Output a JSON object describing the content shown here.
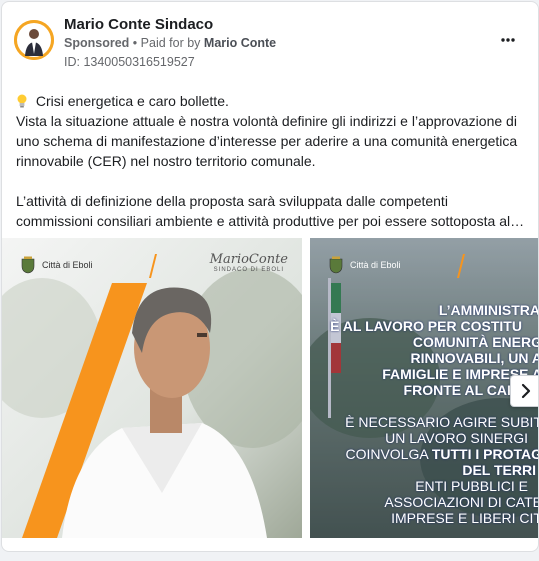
{
  "post": {
    "page_name": "Mario Conte Sindaco",
    "sponsored": "Sponsored",
    "bullet": "•",
    "paid_for_prefix": "Paid for by",
    "paid_for_name": "Mario Conte",
    "ad_id": "ID: 1340050316519527",
    "text": {
      "line1": "Crisi energetica e caro bollette.",
      "para1": "Vista la situazione attuale è nostra volontà definire gli indirizzi e l’approvazione di uno schema di manifestazione d’interesse per aderire a una comunità energetica rinnovabile (CER) nel nostro territorio comunale.",
      "para2": "L’attività di definizione della proposta sarà sviluppata dalle competenti commissioni consiliari ambiente e attività produttive per poi essere sottoposta al…"
    }
  },
  "carousel": {
    "slide1": {
      "city_label": "Città di Eboli",
      "signature": "MarioConte",
      "signature_sub": "SINDACO DI EBOLI"
    },
    "slide2": {
      "city_label": "Città di Eboli",
      "headline": [
        "L’AMMINISTRA",
        "È AL LAVORO PER COSTITU",
        "COMUNITÀ ENERG",
        "RINNOVABILI, UN A",
        "FAMIGLIE E IMPRESE A",
        "FRONTE AL CARO"
      ],
      "body": [
        "È NECESSARIO AGIRE SUBIT",
        "UN LAVORO SINERGI"
      ],
      "body_line3_pre": "COINVOLGA ",
      "body_line3_bold": "TUTTI I PROTAG",
      "body_line4": "DEL TERRI",
      "body_rest": [
        "ENTI PUBBLICI E",
        "ASSOCIAZIONI DI CATE",
        "IMPRESE E LIBERI CIT"
      ]
    }
  },
  "colors": {
    "accent_orange": "#f7941d",
    "text_primary": "#1c1e21",
    "text_secondary": "#65676b"
  },
  "icons": {
    "more": "three-dots-icon",
    "bulb": "light-bulb-icon",
    "next": "chevron-right-icon"
  }
}
